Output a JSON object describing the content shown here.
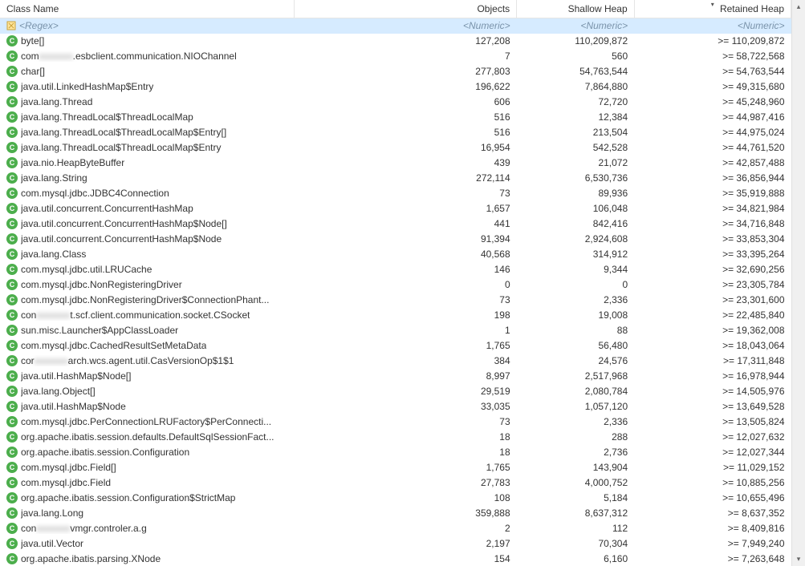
{
  "columns": {
    "class_name": "Class Name",
    "objects": "Objects",
    "shallow": "Shallow Heap",
    "retained": "Retained Heap"
  },
  "filter_row": {
    "regex": "<Regex>",
    "numeric": "<Numeric>"
  },
  "rows": [
    {
      "name": "byte[]",
      "objects": "127,208",
      "shallow": "110,209,872",
      "retained": ">= 110,209,872"
    },
    {
      "name_pre": "com",
      "name_mid": "redacted",
      "name_post": ".esbclient.communication.NIOChannel",
      "objects": "7",
      "shallow": "560",
      "retained": ">= 58,722,568"
    },
    {
      "name": "char[]",
      "objects": "277,803",
      "shallow": "54,763,544",
      "retained": ">= 54,763,544"
    },
    {
      "name": "java.util.LinkedHashMap$Entry",
      "objects": "196,622",
      "shallow": "7,864,880",
      "retained": ">= 49,315,680"
    },
    {
      "name": "java.lang.Thread",
      "objects": "606",
      "shallow": "72,720",
      "retained": ">= 45,248,960"
    },
    {
      "name": "java.lang.ThreadLocal$ThreadLocalMap",
      "objects": "516",
      "shallow": "12,384",
      "retained": ">= 44,987,416"
    },
    {
      "name": "java.lang.ThreadLocal$ThreadLocalMap$Entry[]",
      "objects": "516",
      "shallow": "213,504",
      "retained": ">= 44,975,024"
    },
    {
      "name": "java.lang.ThreadLocal$ThreadLocalMap$Entry",
      "objects": "16,954",
      "shallow": "542,528",
      "retained": ">= 44,761,520"
    },
    {
      "name": "java.nio.HeapByteBuffer",
      "objects": "439",
      "shallow": "21,072",
      "retained": ">= 42,857,488"
    },
    {
      "name": "java.lang.String",
      "objects": "272,114",
      "shallow": "6,530,736",
      "retained": ">= 36,856,944"
    },
    {
      "name": "com.mysql.jdbc.JDBC4Connection",
      "objects": "73",
      "shallow": "89,936",
      "retained": ">= 35,919,888"
    },
    {
      "name": "java.util.concurrent.ConcurrentHashMap",
      "objects": "1,657",
      "shallow": "106,048",
      "retained": ">= 34,821,984"
    },
    {
      "name": "java.util.concurrent.ConcurrentHashMap$Node[]",
      "objects": "441",
      "shallow": "842,416",
      "retained": ">= 34,716,848"
    },
    {
      "name": "java.util.concurrent.ConcurrentHashMap$Node",
      "objects": "91,394",
      "shallow": "2,924,608",
      "retained": ">= 33,853,304"
    },
    {
      "name": "java.lang.Class",
      "objects": "40,568",
      "shallow": "314,912",
      "retained": ">= 33,395,264"
    },
    {
      "name": "com.mysql.jdbc.util.LRUCache",
      "objects": "146",
      "shallow": "9,344",
      "retained": ">= 32,690,256"
    },
    {
      "name": "com.mysql.jdbc.NonRegisteringDriver",
      "objects": "0",
      "shallow": "0",
      "retained": ">= 23,305,784"
    },
    {
      "name": "com.mysql.jdbc.NonRegisteringDriver$ConnectionPhant...",
      "objects": "73",
      "shallow": "2,336",
      "retained": ">= 23,301,600"
    },
    {
      "name_pre": "con",
      "name_mid": "redacted",
      "name_post": "t.scf.client.communication.socket.CSocket",
      "objects": "198",
      "shallow": "19,008",
      "retained": ">= 22,485,840"
    },
    {
      "name": "sun.misc.Launcher$AppClassLoader",
      "objects": "1",
      "shallow": "88",
      "retained": ">= 19,362,008"
    },
    {
      "name": "com.mysql.jdbc.CachedResultSetMetaData",
      "objects": "1,765",
      "shallow": "56,480",
      "retained": ">= 18,043,064"
    },
    {
      "name_pre": "cor",
      "name_mid": "redacted",
      "name_post": "arch.wcs.agent.util.CasVersionOp$1$1",
      "objects": "384",
      "shallow": "24,576",
      "retained": ">= 17,311,848"
    },
    {
      "name": "java.util.HashMap$Node[]",
      "objects": "8,997",
      "shallow": "2,517,968",
      "retained": ">= 16,978,944"
    },
    {
      "name": "java.lang.Object[]",
      "objects": "29,519",
      "shallow": "2,080,784",
      "retained": ">= 14,505,976"
    },
    {
      "name": "java.util.HashMap$Node",
      "objects": "33,035",
      "shallow": "1,057,120",
      "retained": ">= 13,649,528"
    },
    {
      "name": "com.mysql.jdbc.PerConnectionLRUFactory$PerConnecti...",
      "objects": "73",
      "shallow": "2,336",
      "retained": ">= 13,505,824"
    },
    {
      "name": "org.apache.ibatis.session.defaults.DefaultSqlSessionFact...",
      "objects": "18",
      "shallow": "288",
      "retained": ">= 12,027,632"
    },
    {
      "name": "org.apache.ibatis.session.Configuration",
      "objects": "18",
      "shallow": "2,736",
      "retained": ">= 12,027,344"
    },
    {
      "name": "com.mysql.jdbc.Field[]",
      "objects": "1,765",
      "shallow": "143,904",
      "retained": ">= 11,029,152"
    },
    {
      "name": "com.mysql.jdbc.Field",
      "objects": "27,783",
      "shallow": "4,000,752",
      "retained": ">= 10,885,256"
    },
    {
      "name": "org.apache.ibatis.session.Configuration$StrictMap",
      "objects": "108",
      "shallow": "5,184",
      "retained": ">= 10,655,496"
    },
    {
      "name": "java.lang.Long",
      "objects": "359,888",
      "shallow": "8,637,312",
      "retained": ">= 8,637,352"
    },
    {
      "name_pre": "con",
      "name_mid": "redacted",
      "name_post": "vmgr.controler.a.g",
      "objects": "2",
      "shallow": "112",
      "retained": ">= 8,409,816"
    },
    {
      "name": "java.util.Vector",
      "objects": "2,197",
      "shallow": "70,304",
      "retained": ">= 7,949,240"
    },
    {
      "name": "org.apache.ibatis.parsing.XNode",
      "objects": "154",
      "shallow": "6,160",
      "retained": ">= 7,263,648"
    }
  ]
}
